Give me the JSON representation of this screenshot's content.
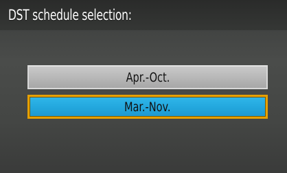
{
  "header": {
    "title": "DST schedule selection:"
  },
  "options": [
    {
      "label": "Apr.-Oct.",
      "state": "normal"
    },
    {
      "label": "Mar.-Nov.",
      "state": "selected"
    }
  ],
  "colors": {
    "background": "#444644",
    "option_normal": "#b9b9b9",
    "option_selected": "#27aee2",
    "selection_border": "#e6a000"
  }
}
